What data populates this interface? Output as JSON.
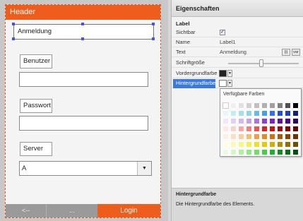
{
  "form": {
    "header": "Header",
    "label_text": "Anmeldung",
    "user_label": "Benutzer",
    "password_label": "Passwort",
    "server_label": "Server",
    "server_value": "A",
    "footer": {
      "back": "<--",
      "more": "...",
      "login": "Login"
    }
  },
  "props": {
    "title": "Eigenschaften",
    "section": "Label",
    "rows": {
      "visible": "Sichtbar",
      "visible_check": "✓",
      "name": "Name",
      "name_value": "Label1",
      "text": "Text",
      "text_value": "Anmeldung",
      "text_btn1": "|||",
      "text_btn2": "var",
      "font_size": "Schriftgröße",
      "foreground": "Vordergrundfarbe",
      "background": "Hintergrundfarbe"
    },
    "foreground_color": "#222222",
    "background_color": "#ffffff",
    "popup_title": "Verfügbare Farben",
    "palette": [
      [
        "#ffffff",
        "#f0f0f0",
        "#e0e0e0",
        "#d0d0d0",
        "#c0c0c0",
        "#b0b0b0",
        "#a0a0a0",
        "#808080",
        "#505050",
        "#000000"
      ],
      [
        "#e6f7f7",
        "#bff0f0",
        "#a6e0e8",
        "#8fd4e8",
        "#5fbfe8",
        "#3fa0f0",
        "#3070f0",
        "#2050e0",
        "#2040c0",
        "#102080"
      ],
      [
        "#f0e8f8",
        "#e0d0f0",
        "#d0b8f0",
        "#c8a0e8",
        "#b070e0",
        "#9040d0",
        "#8020c0",
        "#6010a0",
        "#500090",
        "#300060"
      ],
      [
        "#fde8e8",
        "#fbd0d0",
        "#f8a8a8",
        "#f08080",
        "#f05050",
        "#e02020",
        "#c81010",
        "#a00808",
        "#800000",
        "#600000"
      ],
      [
        "#fdf0e0",
        "#fbe0c0",
        "#f8d0a0",
        "#f0c070",
        "#f0a040",
        "#e88820",
        "#d07010",
        "#b05808",
        "#904000",
        "#703000"
      ],
      [
        "#fdfde0",
        "#fbfbb0",
        "#f8f880",
        "#f0f050",
        "#f0e020",
        "#e8c800",
        "#d0b000",
        "#b09000",
        "#907000",
        "#705000"
      ],
      [
        "#eafbe0",
        "#d0f8c0",
        "#b0f0a0",
        "#90e880",
        "#70e060",
        "#40d040",
        "#20b030",
        "#109020",
        "#087010",
        "#005010"
      ]
    ]
  },
  "help": {
    "title": "Hintergrundfarbe",
    "text": "Die Hintergrundfarbe des Elements."
  }
}
